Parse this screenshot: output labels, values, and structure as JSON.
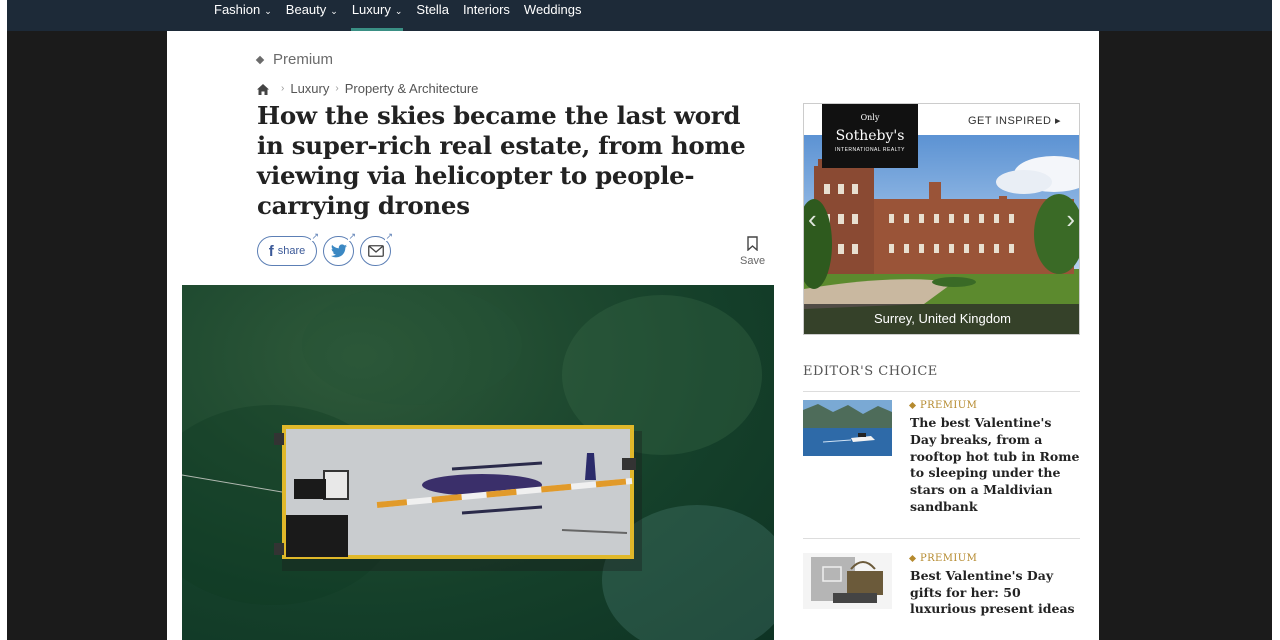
{
  "nav": {
    "items": [
      {
        "label": "Fashion",
        "has_dropdown": true,
        "active": false
      },
      {
        "label": "Beauty",
        "has_dropdown": true,
        "active": false
      },
      {
        "label": "Luxury",
        "has_dropdown": true,
        "active": true
      },
      {
        "label": "Stella",
        "has_dropdown": false,
        "active": false
      },
      {
        "label": "Interiors",
        "has_dropdown": false,
        "active": false
      },
      {
        "label": "Weddings",
        "has_dropdown": false,
        "active": false
      }
    ],
    "chevron": "⌄"
  },
  "article": {
    "premium_label": "Premium",
    "breadcrumb": [
      "Luxury",
      "Property & Architecture"
    ],
    "headline": "How the skies became the last word in super-rich real estate, from home viewing via helicopter to people-carrying drones",
    "share": {
      "facebook_label": "share"
    },
    "save_label": "Save"
  },
  "ad": {
    "only": "Only",
    "brand": "Sotheby's",
    "brand_sub": "INTERNATIONAL REALTY",
    "cta": "GET INSPIRED ▸",
    "caption": "Surrey, United Kingdom"
  },
  "editors_choice": {
    "title": "EDITOR'S CHOICE",
    "items": [
      {
        "label": "PREMIUM",
        "headline": "The best Valentine's Day breaks, from a rooftop hot tub in Rome to sleeping under the stars on a Maldivian sandbank"
      },
      {
        "label": "PREMIUM",
        "headline": "Best Valentine's Day gifts for her: 50 luxurious present ideas"
      }
    ]
  },
  "colors": {
    "nav_bg": "#1d2a38",
    "nav_active_underline": "#3a8f84",
    "premium_gold": "#b58a2e",
    "share_blue": "#3b5998"
  }
}
